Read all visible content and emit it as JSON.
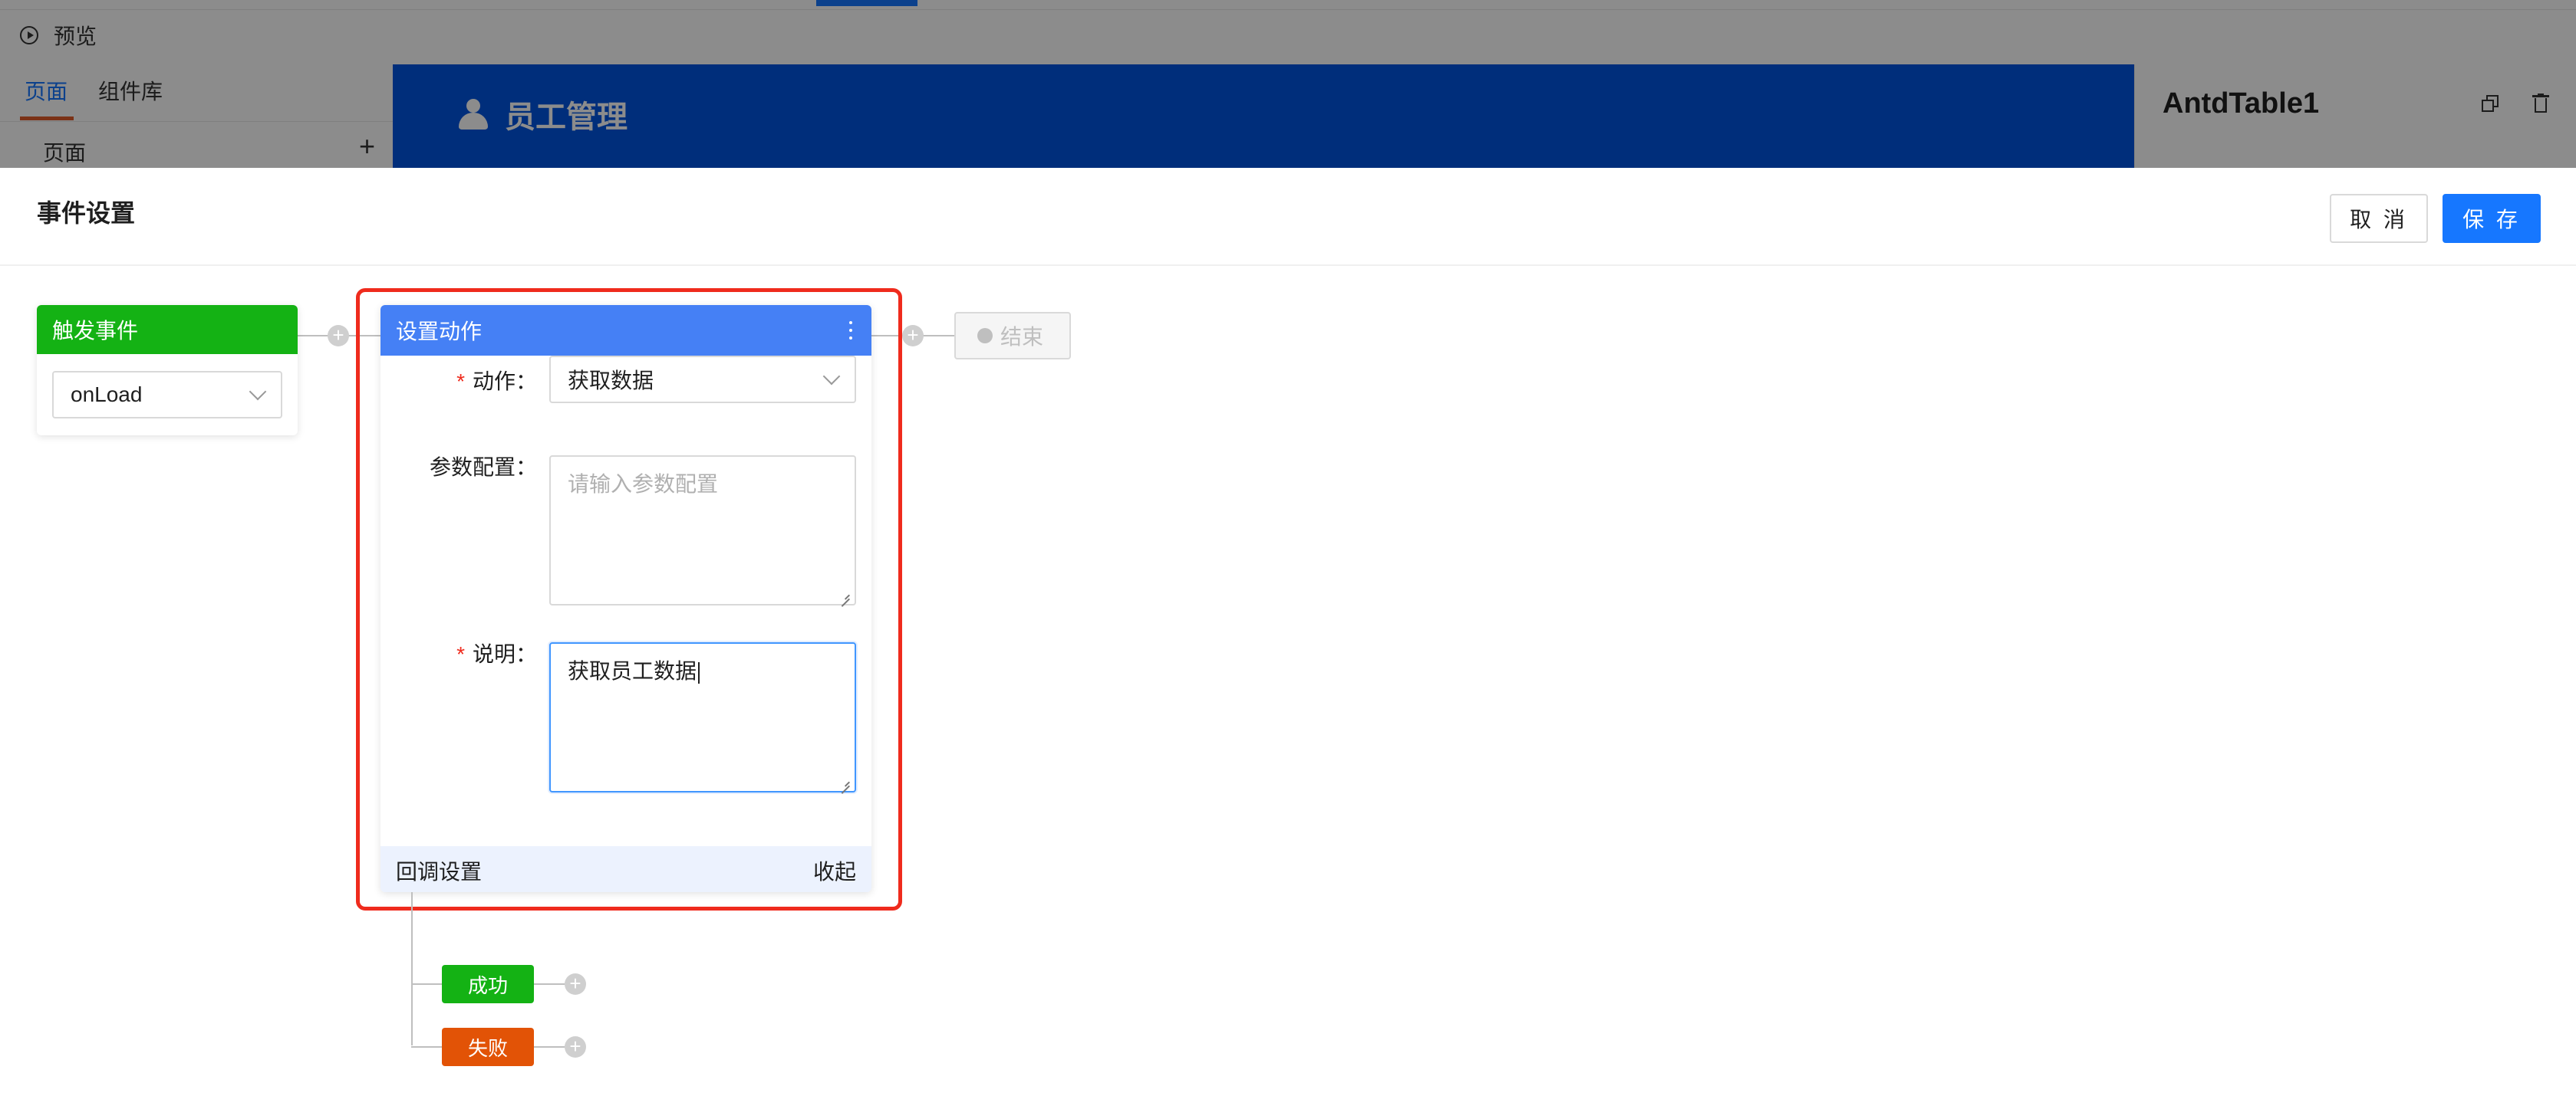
{
  "background": {
    "preview_label": "预览",
    "tabs": [
      {
        "label": "页面",
        "active": true
      },
      {
        "label": "组件库",
        "active": false
      }
    ],
    "pages_label": "页面",
    "add_page_label": "+",
    "canvas_title": "员工管理",
    "component_name": "AntdTable1",
    "icons": [
      "play-circle-icon",
      "user-group-icon",
      "copy-icon",
      "trash-icon"
    ]
  },
  "drawer": {
    "title": "事件设置",
    "cancel_label": "取 消",
    "save_label": "保 存"
  },
  "flow": {
    "trigger": {
      "title": "触发事件",
      "event": "onLoad"
    },
    "action": {
      "title": "设置动作",
      "action_label": "动作",
      "action_value": "获取数据",
      "params_label": "参数配置",
      "params_placeholder": "请输入参数配置",
      "desc_label": "说明",
      "desc_value": "获取员工数据",
      "callback_label": "回调设置",
      "collapse_label": "收起"
    },
    "end_label": "结束",
    "success_label": "成功",
    "fail_label": "失败"
  },
  "colors": {
    "primary": "#1677ff",
    "trigger_green": "#14b214",
    "action_blue": "#4580f5",
    "fail_orange": "#e25306",
    "highlight_red": "#ef2b1d"
  }
}
